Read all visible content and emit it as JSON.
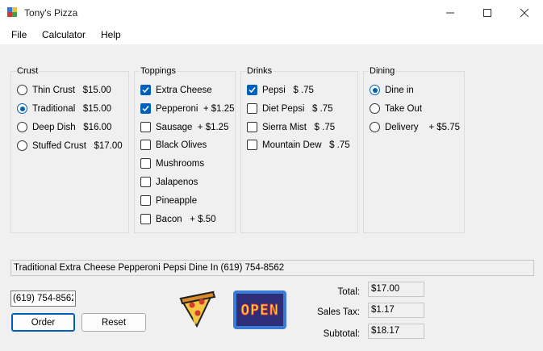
{
  "window": {
    "title": "Tony's Pizza"
  },
  "menu": [
    "File",
    "Calculator",
    "Help"
  ],
  "groups": {
    "crust": {
      "label": "Crust",
      "options": [
        {
          "label": "Thin Crust   $15.00",
          "selected": false
        },
        {
          "label": "Traditional   $15.00",
          "selected": true
        },
        {
          "label": "Deep Dish   $16.00",
          "selected": false
        },
        {
          "label": "Stuffed Crust   $17.00",
          "selected": false
        }
      ]
    },
    "toppings": {
      "label": "Toppings",
      "options": [
        {
          "label": "Extra Cheese",
          "checked": true
        },
        {
          "label": "Pepperoni  + $1.25",
          "checked": true
        },
        {
          "label": "Sausage  + $1.25",
          "checked": false
        },
        {
          "label": "Black Olives",
          "checked": false
        },
        {
          "label": "Mushrooms",
          "checked": false
        },
        {
          "label": "Jalapenos",
          "checked": false
        },
        {
          "label": "Pineapple",
          "checked": false
        },
        {
          "label": "Bacon   + $.50",
          "checked": false
        }
      ]
    },
    "drinks": {
      "label": "Drinks",
      "options": [
        {
          "label": "Pepsi   $ .75",
          "checked": true
        },
        {
          "label": "Diet Pepsi   $ .75",
          "checked": false
        },
        {
          "label": "Sierra Mist   $ .75",
          "checked": false
        },
        {
          "label": "Mountain Dew   $ .75",
          "checked": false
        }
      ]
    },
    "dining": {
      "label": "Dining",
      "options": [
        {
          "label": "Dine in",
          "selected": true
        },
        {
          "label": "Take Out",
          "selected": false
        },
        {
          "label": "Delivery    + $5.75",
          "selected": false
        }
      ]
    }
  },
  "order_summary": "Traditional Extra Cheese Pepperoni Pepsi Dine In (619) 754-8562",
  "phone": {
    "value": "(619) 754-8562"
  },
  "buttons": {
    "order": "Order",
    "reset": "Reset"
  },
  "sign_text": "OPEN",
  "totals": {
    "total": {
      "label": "Total:",
      "value": "$17.00"
    },
    "sales_tax": {
      "label": "Sales Tax:",
      "value": "$1.17"
    },
    "subtotal": {
      "label": "Subtotal:",
      "value": "$18.17"
    }
  },
  "colors": {
    "accent": "#005fb8",
    "sign_frame": "#3a7bd5",
    "sign_text": "#e0342a"
  }
}
